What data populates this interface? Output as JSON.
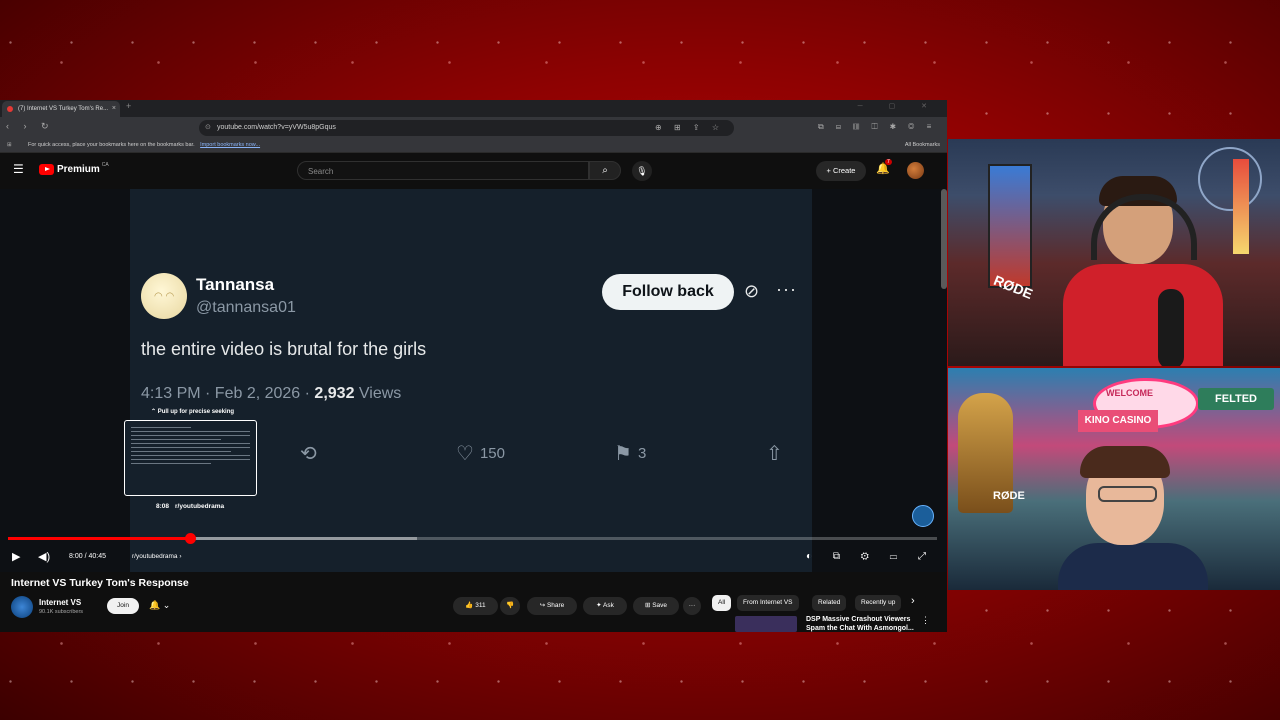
{
  "browser": {
    "tab_title": "(7) Internet VS Turkey Tom's Re...",
    "tab_close": "×",
    "new_tab": "+",
    "window_controls": "─ ▢ ✕",
    "nav_icons": "‹ › ↻",
    "url": "youtube.com/watch?v=yVW5u8pGqus",
    "url_icon": "⊙",
    "url_right_icons": "⊕ ⊞ ⇪ ☆",
    "ext_icons": "⧉ ⊟ ▥ ◫ ✱ ◎ ≡",
    "bookmarks_message": "For quick access, place your bookmarks here on the bookmarks bar.",
    "import_link": "Import bookmarks now...",
    "all_bookmarks": "All Bookmarks",
    "apps_icon": "⊞"
  },
  "youtube": {
    "menu_icon": "☰",
    "logo_text": "Premium",
    "country": "CA",
    "search_placeholder": "Search",
    "search_icon": "⌕",
    "mic_icon": "🎙",
    "create_label": "+ Create",
    "bell_icon": "🔔",
    "notification_count": "7"
  },
  "tweet": {
    "name": "Tannansa",
    "handle": "@tannansa01",
    "follow_button": "Follow back",
    "grok_icon": "⊘",
    "more_icon": "···",
    "text": "the entire video is brutal for the girls",
    "time": "4:13 PM · Feb 2, 2026 · ",
    "views_count": "2,932",
    "views_label": " Views",
    "retweet_icon": "⟲",
    "like_icon": "♡",
    "likes": "150",
    "bookmark_icon": "⚑",
    "bookmarks": "3",
    "share_icon": "⇧"
  },
  "player": {
    "pull_up_hint": "⌃ Pull up for precise seeking",
    "preview_time": "8:08",
    "preview_chapter": "r/youtubedrama",
    "play_icon": "▶",
    "volume_icon": "◀)",
    "time": "8:00 / 40:45",
    "chapter": "r/youtubedrama ›",
    "right_controls": "◐ ⧉ ⚙ ▭ ⤢",
    "progress_fraction": 0.196
  },
  "video": {
    "title": "Internet VS Turkey Tom's Response",
    "channel": "Internet VS",
    "subscribers": "90.1K subscribers",
    "join": "Join",
    "subscribe_bell": "🔔 ⌄",
    "likes": "👍 311",
    "dislike": "👎",
    "share": "↪ Share",
    "ask": "✦ Ask",
    "save": "⊞ Save",
    "more": "···"
  },
  "recommendations": {
    "chips": [
      "All",
      "From Internet VS",
      "Related",
      "Recently up"
    ],
    "chips_next": "›",
    "first_title": "DSP Massive Crashout Viewers Spam the Chat With Asmongol...",
    "first_more": "⋮"
  },
  "webcam": {
    "top_mic_brand": "RØDE",
    "bottom_mic_brand": "RØDE",
    "sign_welcome": "WELCOME",
    "sign_kino": "KINO CASINO",
    "sign_felted": "FELTED"
  }
}
